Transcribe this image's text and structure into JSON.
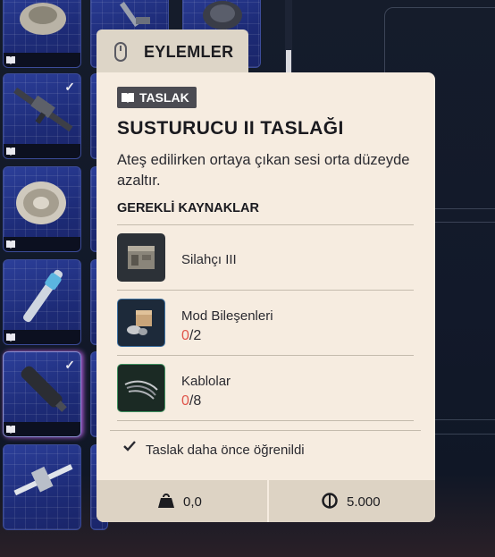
{
  "actions": {
    "label": "EYLEMLER"
  },
  "tooltip": {
    "badge": "TASLAK",
    "title": "SUSTURUCU II TASLAĞI",
    "description": "Ateş edilirken ortaya çıkan sesi orta düzeyde azaltır.",
    "requirements_heading": "GEREKLİ KAYNAKLAR",
    "requirements": [
      {
        "name": "Silahçı III",
        "icon": "workbench-icon"
      },
      {
        "name": "Mod Bileşenleri",
        "have": "0",
        "need": "/2",
        "icon": "mod-components-icon"
      },
      {
        "name": "Kablolar",
        "have": "0",
        "need": "/8",
        "icon": "wires-icon"
      }
    ],
    "learned_text": "Taslak daha önce öğrenildi",
    "weight": "0,0",
    "price": "5.000"
  },
  "colors": {
    "accent_red": "#e0564b",
    "card_bg": "#f6ece0",
    "slot_blue": "#24348a"
  }
}
